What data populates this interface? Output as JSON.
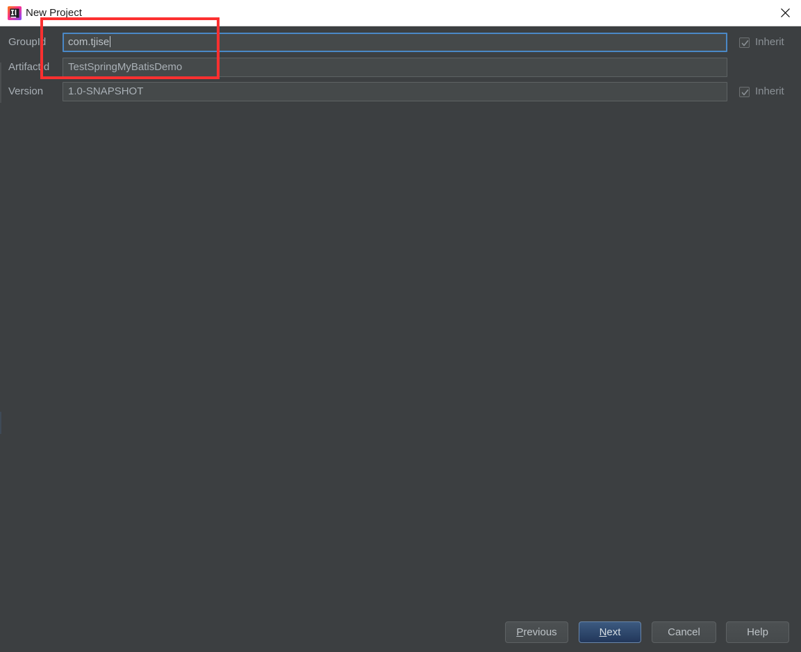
{
  "window": {
    "title": "New Project",
    "app_icon": "intellij-idea-icon",
    "close_icon": "close-icon"
  },
  "form": {
    "fields": [
      {
        "label": "GroupId",
        "value": "com.tjise",
        "placeholder": "",
        "focused": true,
        "inherit": {
          "label": "Inherit",
          "checked": true,
          "enabled": false
        }
      },
      {
        "label": "ArtifactId",
        "value": "TestSpringMyBatisDemo",
        "placeholder": "",
        "focused": false,
        "inherit": null
      },
      {
        "label": "Version",
        "value": "1.0-SNAPSHOT",
        "placeholder": "",
        "focused": false,
        "inherit": {
          "label": "Inherit",
          "checked": true,
          "enabled": false
        }
      }
    ]
  },
  "buttons": {
    "previous": {
      "label": "Previous",
      "mnemonic": "P",
      "prefix": "",
      "rest": "revious"
    },
    "next": {
      "label": "Next",
      "mnemonic": "N",
      "prefix": "",
      "rest": "ext",
      "default": true
    },
    "cancel": {
      "label": "Cancel"
    },
    "help": {
      "label": "Help"
    }
  },
  "annotation": {
    "shape": "rectangle",
    "color": "#fc3030"
  },
  "colors": {
    "dialog_background": "#3c3f41",
    "titlebar_background": "#ffffff",
    "field_background": "#45494a",
    "field_border": "#5e6364",
    "focus_border": "#4a88c7",
    "label_text": "#a9b0b6",
    "default_button_background": "#2e4a72",
    "annotation": "#fc3030"
  }
}
